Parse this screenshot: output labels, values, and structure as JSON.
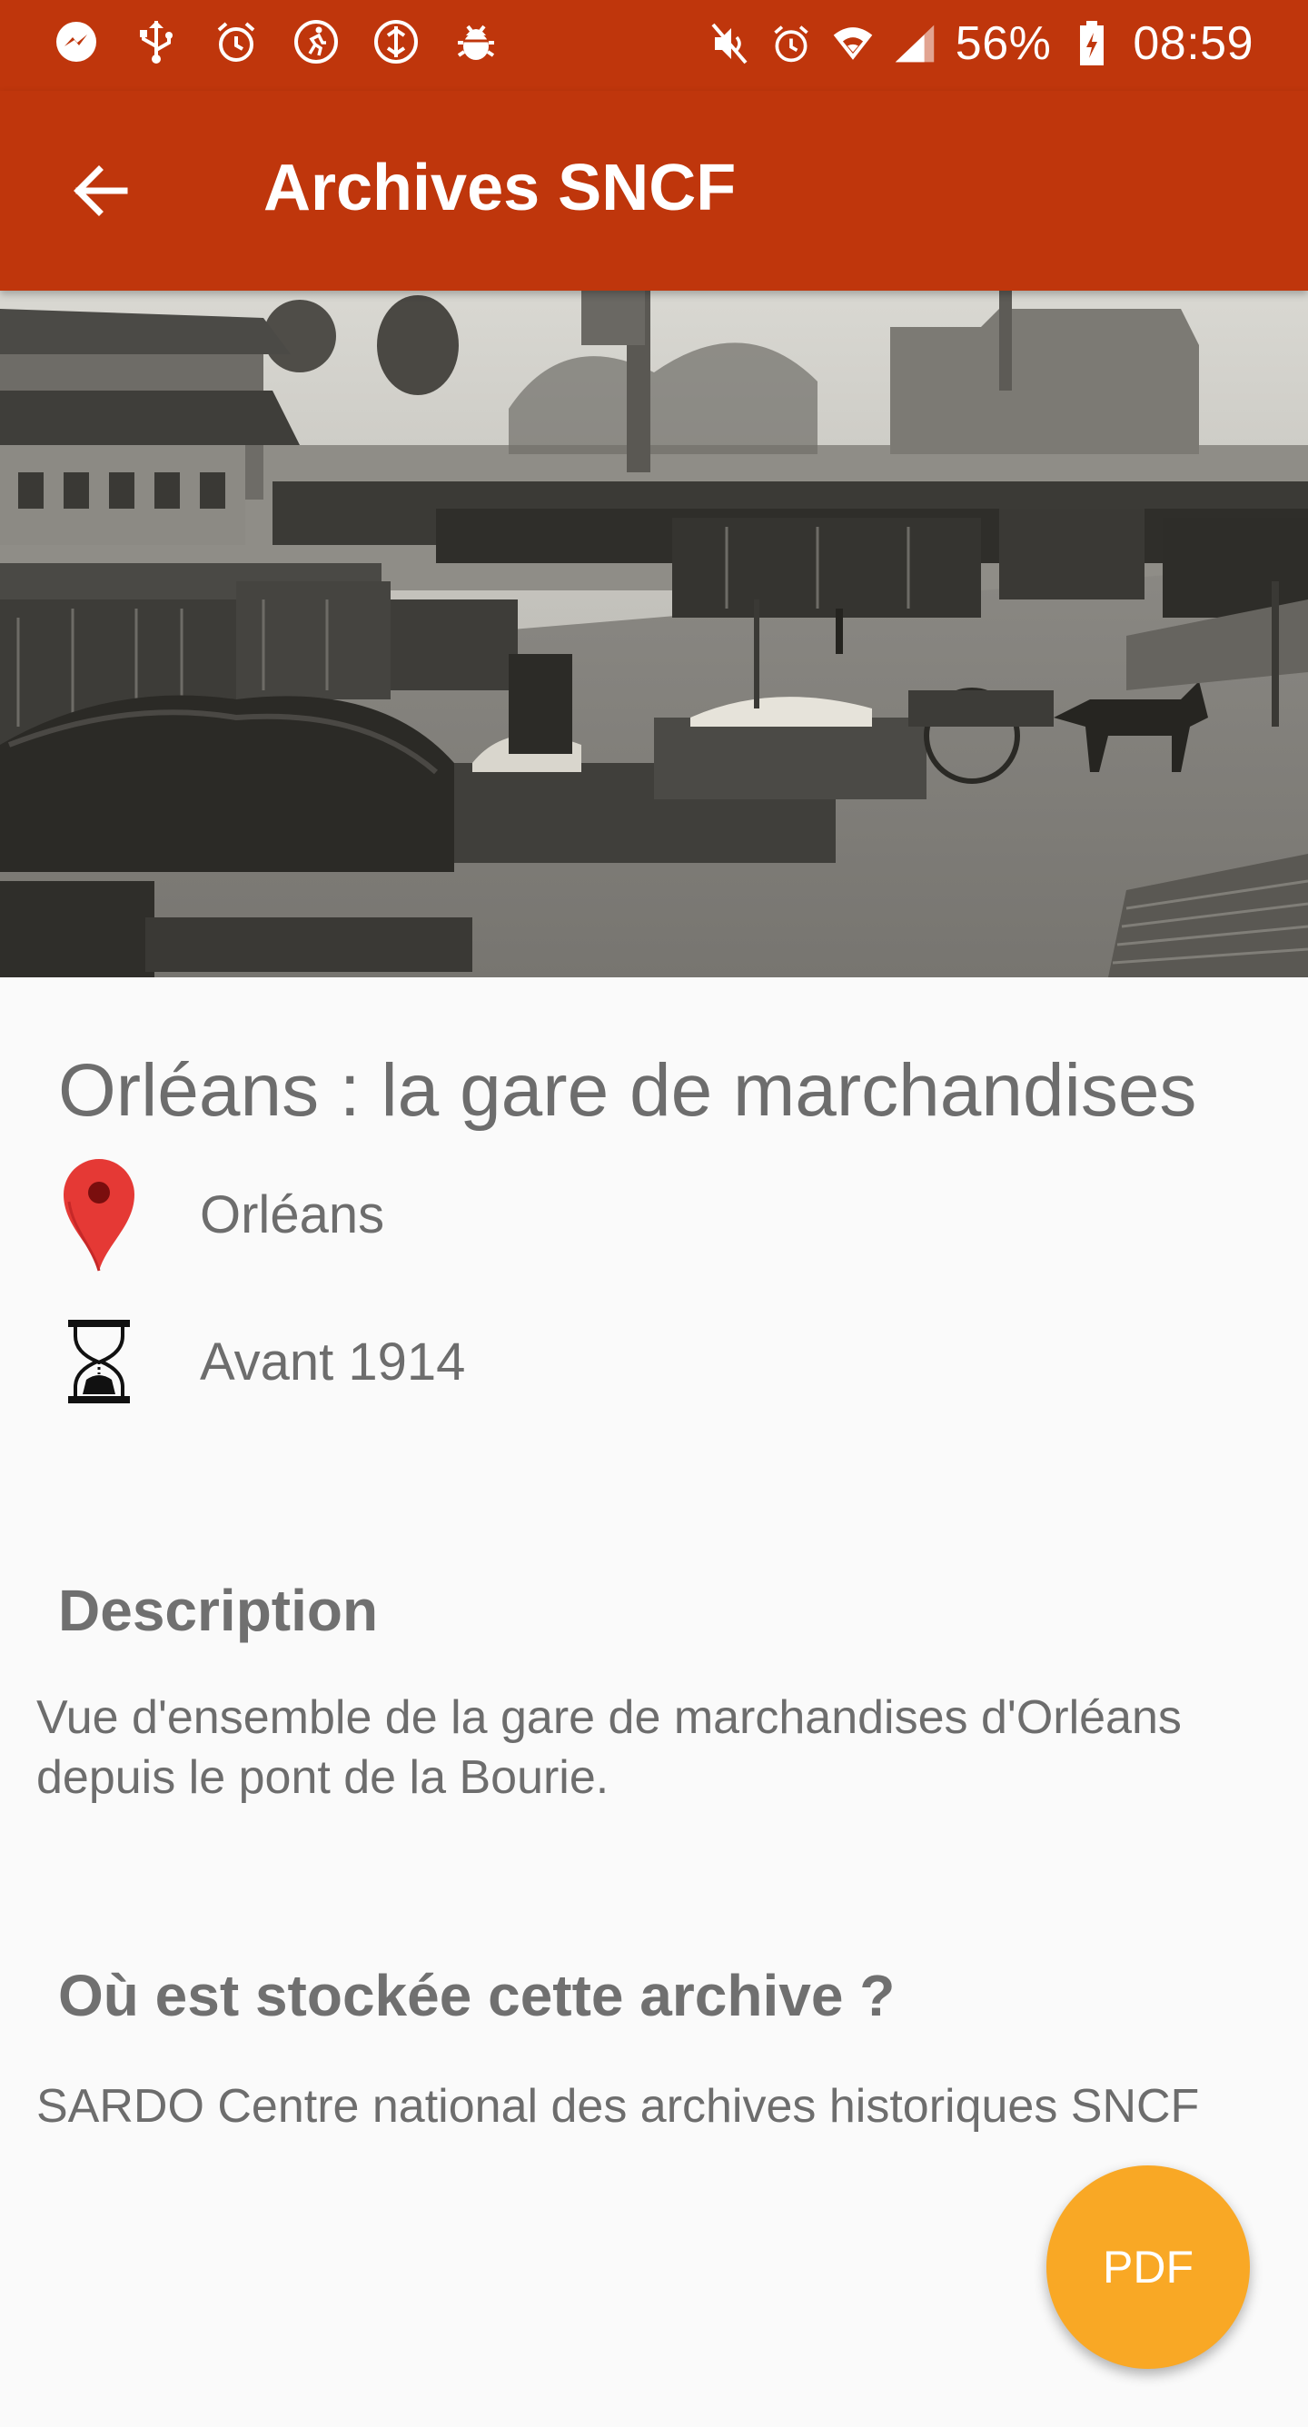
{
  "status_bar": {
    "left_icons": [
      "messenger-icon",
      "usb-icon",
      "alarm-icon",
      "activity-icon",
      "sync-icon",
      "debug-icon"
    ],
    "right_icons": [
      "mute-icon",
      "alarm-icon",
      "wifi-icon",
      "signal-icon",
      "battery-icon"
    ],
    "battery": "56%",
    "time": "08:59"
  },
  "app_bar": {
    "title": "Archives SNCF",
    "back_icon": "arrow-back-icon",
    "color": "#bf360c"
  },
  "archive": {
    "title": "Orléans : la gare de marchandises",
    "place": "Orléans",
    "place_icon": "map-pin-icon",
    "date": "Avant 1914",
    "date_icon": "hourglass-icon",
    "description_heading": "Description",
    "description": "Vue d'ensemble de la gare de marchandises d'Orléans depuis le pont de la Bourie.",
    "storage_heading": "Où est stockée cette archive ?",
    "storage": "SARDO Centre national des archives historiques SNCF"
  },
  "fab": {
    "label": "PDF",
    "color": "#f9a825"
  }
}
